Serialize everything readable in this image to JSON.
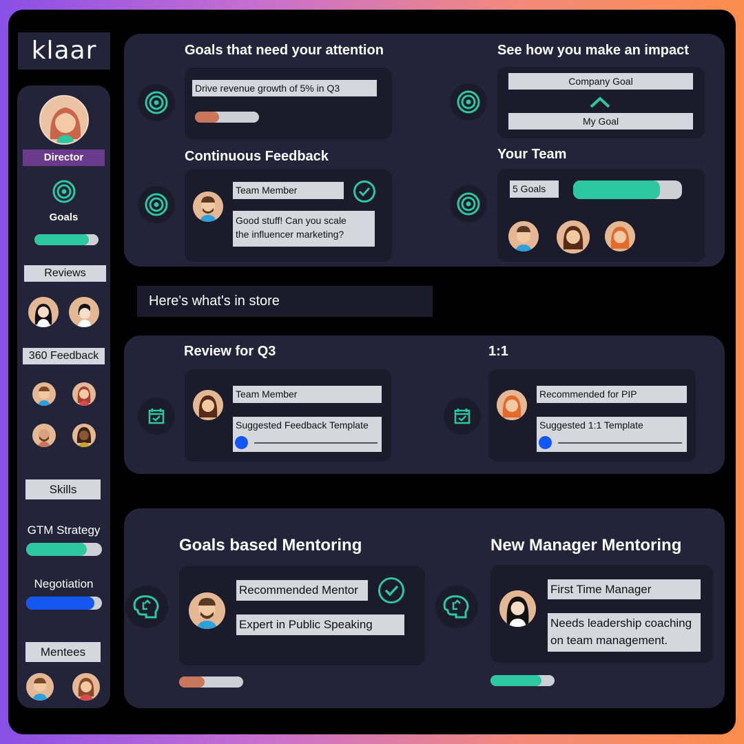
{
  "brand": {
    "logo": "klaar"
  },
  "colors": {
    "teal": "#2ec8a0",
    "orange": "#c9775a",
    "blue": "#1456f0",
    "purple": "#6a3a8c",
    "panel": "#23243a",
    "card": "#1b1b2b"
  },
  "sidebar": {
    "role_badge": "Director",
    "goals_label": "Goals",
    "goals_progress": 0.85,
    "reviews_label": "Reviews",
    "feedback_label": "360 Feedback",
    "skills_label": "Skills",
    "skills": [
      {
        "name": "GTM Strategy",
        "progress": 0.8,
        "color": "teal"
      },
      {
        "name": "Negotiation",
        "progress": 0.88,
        "color": "blue"
      }
    ],
    "mentees_label": "Mentees"
  },
  "goals_attention": {
    "title": "Goals that need your attention",
    "goal": "Drive revenue growth of 5% in Q3",
    "progress": 0.38
  },
  "impact": {
    "title": "See how you make an impact",
    "company_goal": "Company Goal",
    "my_goal": "My Goal"
  },
  "feedback": {
    "title": "Continuous Feedback",
    "who": "Team Member",
    "message_line1": "Good stuff! Can you scale",
    "message_line2": "the influencer marketing?"
  },
  "team": {
    "title": "Your Team",
    "goals": "5 Goals",
    "progress": 0.79
  },
  "store": {
    "label": "Here's what's in store"
  },
  "review": {
    "title": "Review for Q3",
    "who": "Team Member",
    "template": "Suggested Feedback Template"
  },
  "one_on_one": {
    "title": "1:1",
    "who": "Recommended for PIP",
    "template": "Suggested 1:1 Template"
  },
  "mentoring_goals": {
    "title": "Goals based Mentoring",
    "mentor": "Recommended Mentor",
    "skill": "Expert in Public Speaking",
    "progress": 0.4
  },
  "mentoring_manager": {
    "title": "New Manager Mentoring",
    "who": "First Time Manager",
    "need_line1": "Needs leadership coaching",
    "need_line2": "on team management.",
    "progress": 0.8
  }
}
